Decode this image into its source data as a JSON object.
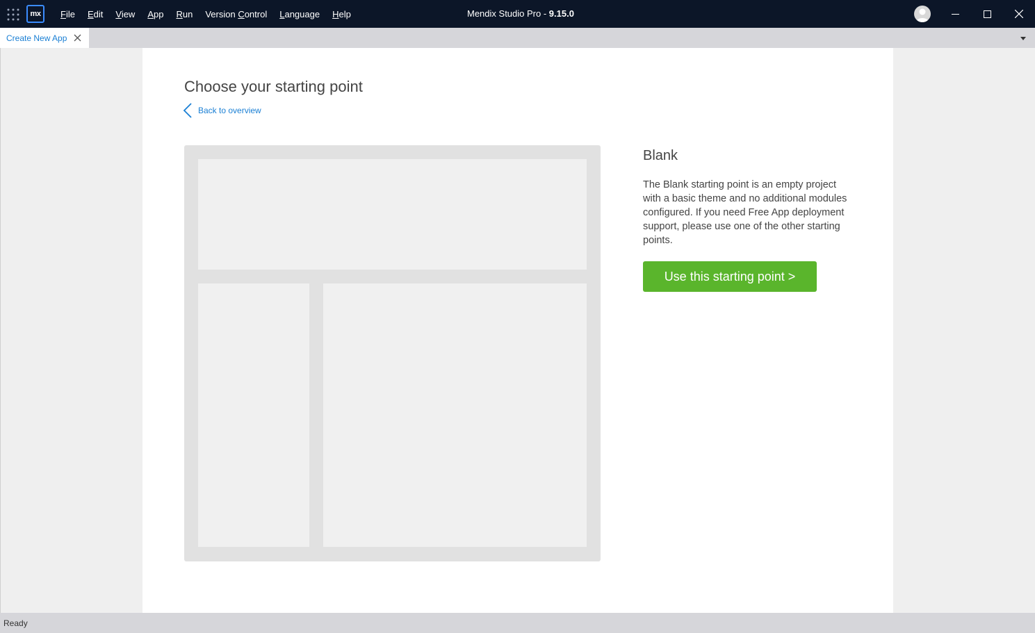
{
  "titlebar": {
    "app_name": "Mendix Studio Pro",
    "separator": " - ",
    "version": "9.15.0",
    "logo_text": "mx",
    "icons": [
      "app-grid-icon",
      "avatar-icon",
      "minimize-icon",
      "maximize-icon",
      "close-icon"
    ]
  },
  "menu": [
    {
      "label": "File",
      "mnemonic": "F",
      "rest": "ile"
    },
    {
      "label": "Edit",
      "mnemonic": "E",
      "rest": "dit"
    },
    {
      "label": "View",
      "mnemonic": "V",
      "rest": "iew"
    },
    {
      "label": "App",
      "mnemonic": "A",
      "rest": "pp"
    },
    {
      "label": "Run",
      "mnemonic": "R",
      "rest": "un"
    },
    {
      "label": "Version Control",
      "pre": "Version ",
      "mnemonic": "C",
      "rest": "ontrol"
    },
    {
      "label": "Language",
      "mnemonic": "L",
      "rest": "anguage"
    },
    {
      "label": "Help",
      "mnemonic": "H",
      "rest": "elp"
    }
  ],
  "tabs": [
    {
      "label": "Create New App",
      "active": true
    }
  ],
  "page": {
    "title": "Choose your starting point",
    "back_label": "Back to overview"
  },
  "template": {
    "name": "Blank",
    "description": "The Blank starting point is an empty project with a basic theme and no additional modules configured. If you need Free App deployment support, please use one of the other starting points.",
    "button_label": "Use this starting point >"
  },
  "status": {
    "text": "Ready"
  },
  "colors": {
    "titlebar_bg": "#0c1628",
    "accent_blue": "#1a7fd4",
    "button_green": "#5ab52c",
    "preview_frame": "#e1e1e1",
    "preview_block": "#f0f0f0"
  }
}
